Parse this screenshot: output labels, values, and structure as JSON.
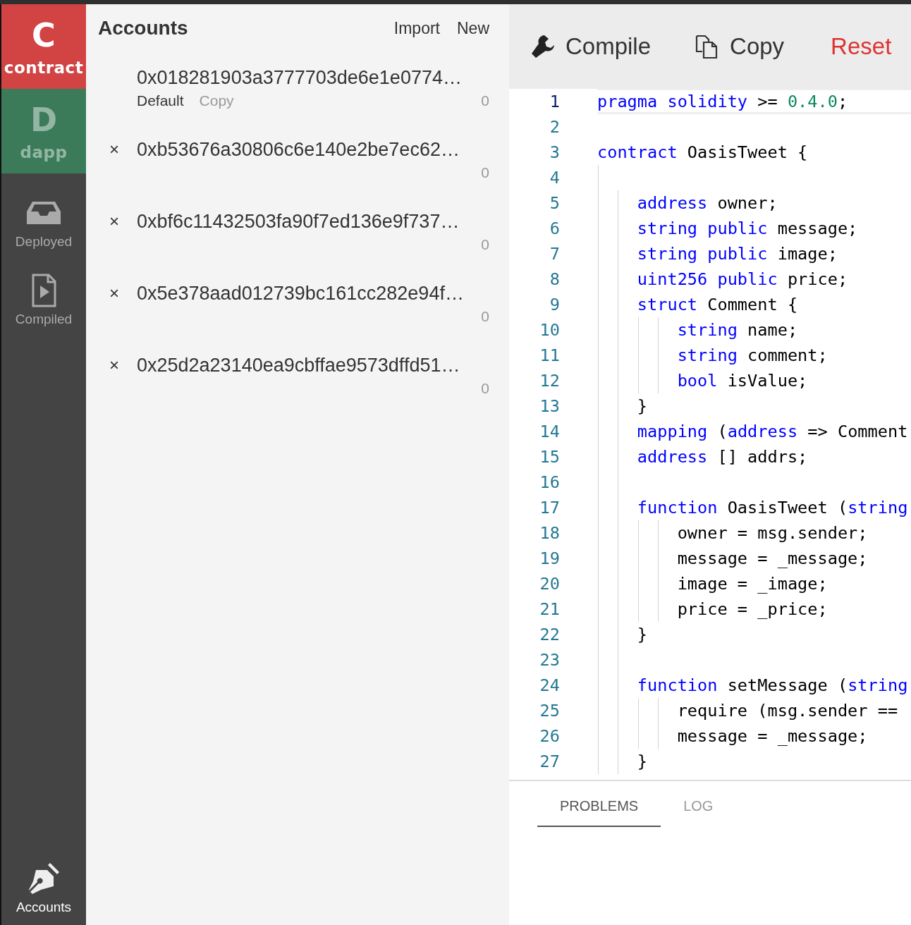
{
  "sidebar": {
    "brands": [
      {
        "letter": "C",
        "label": "contract",
        "color": "#d24444",
        "selected": true
      },
      {
        "letter": "D",
        "label": "dapp",
        "color": "#3b7b59",
        "selected": false
      }
    ],
    "nav": [
      {
        "kind": "deployed",
        "label": "Deployed",
        "selected": false
      },
      {
        "kind": "compiled",
        "label": "Compiled",
        "selected": false
      }
    ],
    "bottom_nav": [
      {
        "kind": "accounts",
        "label": "Accounts",
        "selected": true
      }
    ]
  },
  "accounts": {
    "title": "Accounts",
    "actions": [
      "Import",
      "New"
    ],
    "items": [
      {
        "address": "0x018281903a3777703de6e1e0774…",
        "default_label": "Default",
        "copy_label": "Copy",
        "balance": "0"
      },
      {
        "address": "0xb53676a30806c6e140e2be7ec62…",
        "remove_label": "×",
        "balance": "0"
      },
      {
        "address": "0xbf6c11432503fa90f7ed136e9f737…",
        "remove_label": "×",
        "balance": "0"
      },
      {
        "address": "0x5e378aad012739bc161cc282e94f…",
        "remove_label": "×",
        "balance": "0"
      },
      {
        "address": "0x25d2a23140ea9cbffae9573dffd51…",
        "remove_label": "×",
        "balance": "0"
      }
    ]
  },
  "toolbar": [
    {
      "kind": "compile",
      "label": "Compile"
    },
    {
      "kind": "copy",
      "label": "Copy"
    },
    {
      "kind": "reset",
      "label": "Reset"
    }
  ],
  "editor": {
    "lines": [
      {
        "number": "1",
        "active": true,
        "tokens": [
          {
            "kind": "keyword",
            "text": "pragma solidity"
          },
          {
            "kind": "plain",
            "text": " >= "
          },
          {
            "kind": "number",
            "text": "0.4.0"
          },
          {
            "kind": "plain",
            "text": ";"
          }
        ]
      },
      {
        "number": "2",
        "active": false
      },
      {
        "number": "3",
        "active": false,
        "tokens": [
          {
            "kind": "keyword",
            "text": "contract"
          },
          {
            "kind": "plain",
            "text": " OasisTweet {"
          }
        ]
      },
      {
        "number": "4",
        "active": false
      },
      {
        "number": "5",
        "active": false,
        "tokens": [
          {
            "kind": "keyword",
            "text": "    address"
          },
          {
            "kind": "plain",
            "text": " owner;"
          }
        ]
      },
      {
        "number": "6",
        "active": false,
        "tokens": [
          {
            "kind": "keyword",
            "text": "    string public"
          },
          {
            "kind": "plain",
            "text": " message;"
          }
        ]
      },
      {
        "number": "7",
        "active": false,
        "tokens": [
          {
            "kind": "keyword",
            "text": "    string public"
          },
          {
            "kind": "plain",
            "text": " image;"
          }
        ]
      },
      {
        "number": "8",
        "active": false,
        "tokens": [
          {
            "kind": "keyword",
            "text": "    uint256 public"
          },
          {
            "kind": "plain",
            "text": " price;"
          }
        ]
      },
      {
        "number": "9",
        "active": false,
        "tokens": [
          {
            "kind": "keyword",
            "text": "    struct"
          },
          {
            "kind": "plain",
            "text": " Comment {"
          }
        ]
      },
      {
        "number": "10",
        "active": false,
        "tokens": [
          {
            "kind": "keyword",
            "text": "        string"
          },
          {
            "kind": "plain",
            "text": " name;"
          }
        ]
      },
      {
        "number": "11",
        "active": false,
        "tokens": [
          {
            "kind": "keyword",
            "text": "        string"
          },
          {
            "kind": "plain",
            "text": " comment;"
          }
        ]
      },
      {
        "number": "12",
        "active": false,
        "tokens": [
          {
            "kind": "keyword",
            "text": "        bool"
          },
          {
            "kind": "plain",
            "text": " isValue;"
          }
        ]
      },
      {
        "number": "13",
        "active": false,
        "tokens": [
          {
            "kind": "plain",
            "text": "    }"
          }
        ]
      },
      {
        "number": "14",
        "active": false,
        "tokens": [
          {
            "kind": "keyword",
            "text": "    mapping"
          },
          {
            "kind": "plain",
            "text": " ("
          },
          {
            "kind": "keyword",
            "text": "address"
          },
          {
            "kind": "plain",
            "text": " => Comment"
          }
        ]
      },
      {
        "number": "15",
        "active": false,
        "tokens": [
          {
            "kind": "keyword",
            "text": "    address"
          },
          {
            "kind": "plain",
            "text": " [] addrs;"
          }
        ]
      },
      {
        "number": "16",
        "active": false
      },
      {
        "number": "17",
        "active": false,
        "tokens": [
          {
            "kind": "keyword",
            "text": "    function"
          },
          {
            "kind": "plain",
            "text": " OasisTweet ("
          },
          {
            "kind": "keyword",
            "text": "string"
          }
        ]
      },
      {
        "number": "18",
        "active": false,
        "tokens": [
          {
            "kind": "plain",
            "text": "        owner = msg.sender;"
          }
        ]
      },
      {
        "number": "19",
        "active": false,
        "tokens": [
          {
            "kind": "plain",
            "text": "        message = _message;"
          }
        ]
      },
      {
        "number": "20",
        "active": false,
        "tokens": [
          {
            "kind": "plain",
            "text": "        image = _image;"
          }
        ]
      },
      {
        "number": "21",
        "active": false,
        "tokens": [
          {
            "kind": "plain",
            "text": "        price = _price;"
          }
        ]
      },
      {
        "number": "22",
        "active": false,
        "tokens": [
          {
            "kind": "plain",
            "text": "    }"
          }
        ]
      },
      {
        "number": "23",
        "active": false
      },
      {
        "number": "24",
        "active": false,
        "tokens": [
          {
            "kind": "keyword",
            "text": "    function"
          },
          {
            "kind": "plain",
            "text": " setMessage ("
          },
          {
            "kind": "keyword",
            "text": "string"
          }
        ]
      },
      {
        "number": "25",
        "active": false,
        "tokens": [
          {
            "kind": "plain",
            "text": "        require (msg.sender =="
          }
        ]
      },
      {
        "number": "26",
        "active": false,
        "tokens": [
          {
            "kind": "plain",
            "text": "        message = _message;"
          }
        ]
      },
      {
        "number": "27",
        "active": false,
        "tokens": [
          {
            "kind": "plain",
            "text": "    }"
          }
        ]
      }
    ]
  },
  "bottom_tabs": [
    {
      "label": "PROBLEMS",
      "selected": true
    },
    {
      "label": "LOG",
      "selected": false
    }
  ]
}
